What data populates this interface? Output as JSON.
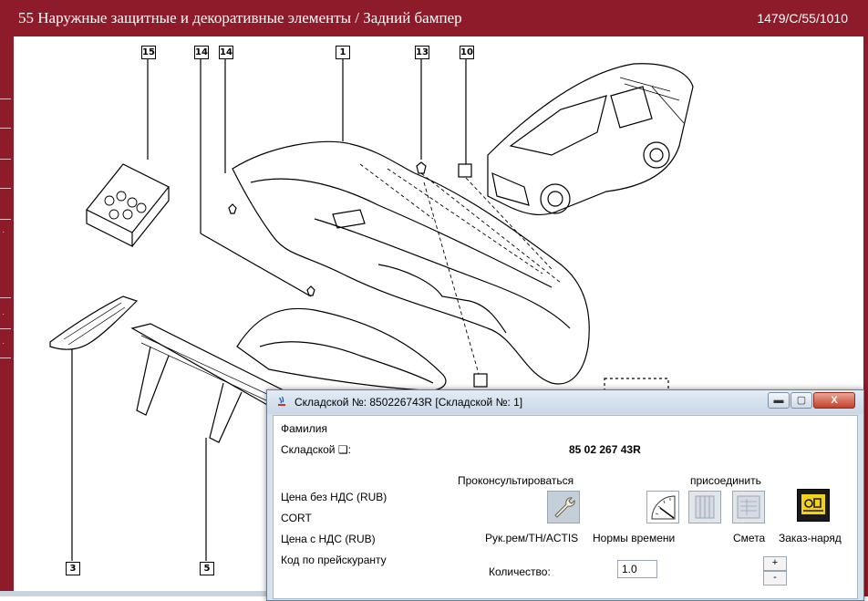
{
  "header": {
    "title": "55 Наружные защитные и декоративные элементы / Задний бампер",
    "ref": "1479/C/55/1010"
  },
  "diagram": {
    "callouts": [
      "15",
      "14",
      "14",
      "1",
      "13",
      "10",
      "3",
      "5"
    ]
  },
  "dialog": {
    "title": "Складской №: 850226743R [Складской №: 1]",
    "window_buttons": {
      "minimize": "▬",
      "maximize": "▢",
      "close": "X"
    },
    "surname_label": "Фамилия",
    "stock_label": "Складской ❏:",
    "stock_value": "85 02 267 43R",
    "consult_label": "Проконсультироваться",
    "attach_label": "присоединить",
    "price_no_vat_label": "Цена без НДС (RUB)",
    "cort_label": "CORT",
    "price_vat_label": "Цена с НДС (RUB)",
    "pricelist_code_label": "Код по прейскуранту",
    "repair_manual_label": "Рук.рем/TH/ACTIS",
    "time_norms_label": "Нормы времени",
    "estimate_label": "Смета",
    "work_order_label": "Заказ-наряд",
    "quantity_label": "Количество:",
    "quantity_value": "1.0",
    "plus_label": "+",
    "minus_label": "-"
  },
  "colors": {
    "brand": "#8e1b2a",
    "dialog_bg": "#d7e1ea"
  }
}
